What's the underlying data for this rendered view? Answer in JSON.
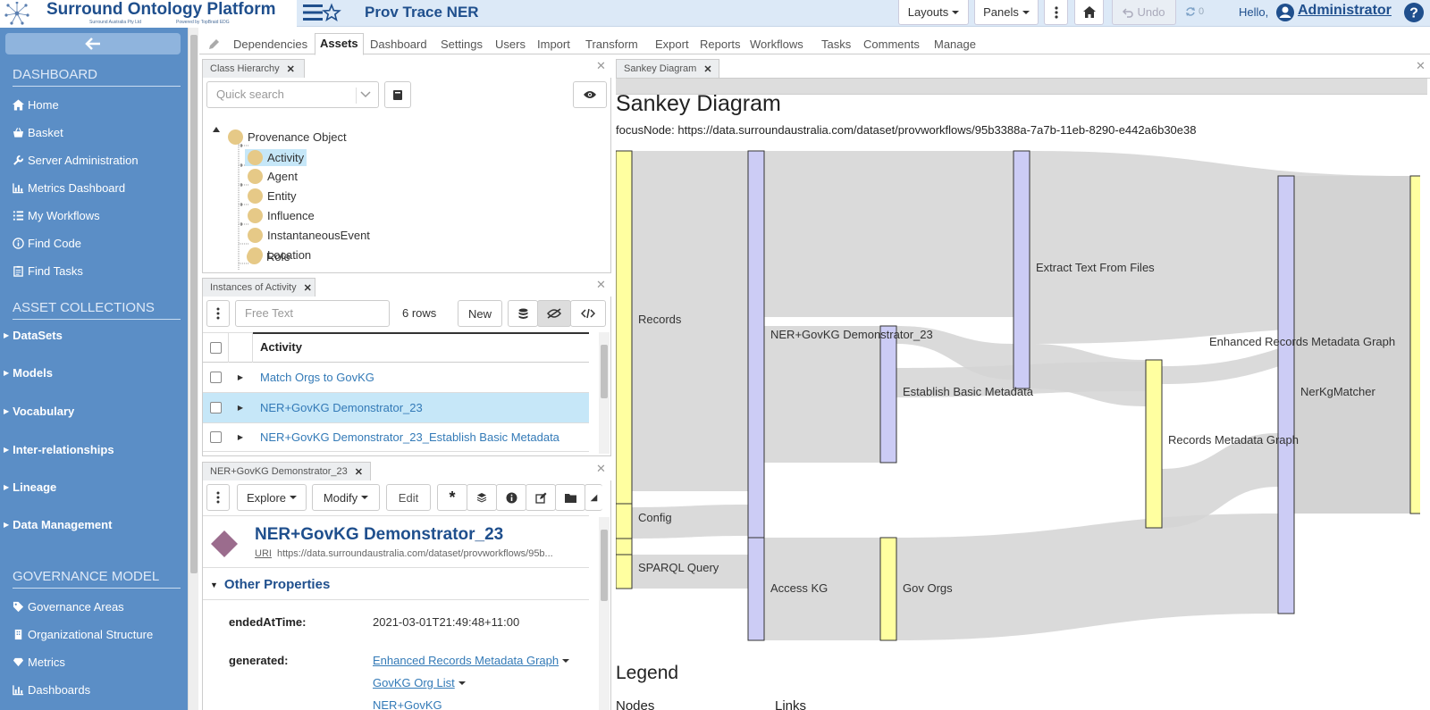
{
  "app": {
    "logo_title": "Surround Ontology Platform",
    "logo_sub_left": "Surround Australia Pty Ltd",
    "logo_sub_right": "Powered by TopBraid EDG",
    "title": "Prov Trace NER",
    "layouts_label": "Layouts",
    "panels_label": "Panels",
    "undo_label": "Undo",
    "redo_count": "0",
    "hello_label": "Hello,",
    "user": "Administrator"
  },
  "sidebar": {
    "sections": [
      {
        "title": "DASHBOARD"
      },
      {
        "title": "ASSET COLLECTIONS"
      },
      {
        "title": "GOVERNANCE MODEL"
      }
    ],
    "dashboard_items": [
      {
        "label": "Home",
        "icon": "home-icon"
      },
      {
        "label": "Basket",
        "icon": "basket-icon"
      },
      {
        "label": "Server Administration",
        "icon": "wrench-icon"
      },
      {
        "label": "Metrics Dashboard",
        "icon": "bar-chart-icon"
      },
      {
        "label": "My Workflows",
        "icon": "list-icon"
      },
      {
        "label": "Find Code",
        "icon": "info-icon"
      },
      {
        "label": "Find Tasks",
        "icon": "clipboard-icon"
      }
    ],
    "collection_items": [
      {
        "label": "DataSets"
      },
      {
        "label": "Models"
      },
      {
        "label": "Vocabulary"
      },
      {
        "label": "Inter-relationships"
      },
      {
        "label": "Lineage"
      },
      {
        "label": "Data Management"
      }
    ],
    "governance_items": [
      {
        "label": "Governance Areas",
        "icon": "tags-icon"
      },
      {
        "label": "Organizational Structure",
        "icon": "building-icon"
      },
      {
        "label": "Metrics",
        "icon": "diamond-icon"
      },
      {
        "label": "Dashboards",
        "icon": "bar-chart-icon"
      }
    ]
  },
  "tabs": [
    "Dependencies",
    "Assets",
    "Dashboard",
    "Settings",
    "Users",
    "Import",
    "Transform",
    "Export",
    "Reports",
    "Workflows",
    "Tasks",
    "Comments",
    "Manage"
  ],
  "active_tab": "Assets",
  "class_hierarchy": {
    "panel_title": "Class Hierarchy",
    "search_placeholder": "Quick search",
    "root": "Provenance Object",
    "children": [
      "Activity",
      "Agent",
      "Entity",
      "Influence",
      "InstantaneousEvent",
      "Location",
      "Role"
    ],
    "selected": "Activity"
  },
  "instances": {
    "panel_title": "Instances of Activity",
    "search_placeholder": "Free Text",
    "rows_label": "6 rows",
    "new_label": "New",
    "column_header": "Activity",
    "rows": [
      "Match Orgs to GovKG",
      "NER+GovKG Demonstrator_23",
      "NER+GovKG Demonstrator_23_Establish Basic Metadata"
    ],
    "selected_index": 1
  },
  "detail": {
    "panel_title": "NER+GovKG Demonstrator_23",
    "explore_label": "Explore",
    "modify_label": "Modify",
    "edit_label": "Edit",
    "name": "NER+GovKG Demonstrator_23",
    "uri_label": "URI",
    "uri": "https://data.surroundaustralia.com/dataset/provworkflows/95b...",
    "section_title": "Other Properties",
    "props": [
      {
        "label": "endedAtTime:",
        "value": "2021-03-01T21:49:48+11:00"
      },
      {
        "label": "generated:",
        "links": [
          "Enhanced Records Metadata Graph",
          "GovKG Org List",
          "NER+GovKG"
        ]
      }
    ]
  },
  "sankey": {
    "panel_title": "Sankey Diagram",
    "heading": "Sankey Diagram",
    "focus": "focusNode: https://data.surroundaustralia.com/dataset/provworkflows/95b3388a-7a7b-11eb-8290-e442a6b30e38",
    "legend_title": "Legend",
    "legend_nodes": "Nodes",
    "legend_links": "Links",
    "colors": {
      "entity": "#ffffa0",
      "activity": "#ccccf5",
      "link": "#d3d3d3"
    },
    "nodes": [
      {
        "id": "records",
        "label": "Records",
        "kind": "entity"
      },
      {
        "id": "config",
        "label": "Config",
        "kind": "entity"
      },
      {
        "id": "sparql",
        "label": "SPARQL Query",
        "kind": "entity"
      },
      {
        "id": "ner",
        "label": "NER+GovKG Demonstrator_23",
        "kind": "activity"
      },
      {
        "id": "access",
        "label": "Access KG",
        "kind": "activity"
      },
      {
        "id": "basic",
        "label": "Establish Basic Metadata",
        "kind": "activity"
      },
      {
        "id": "govorgs",
        "label": "Gov Orgs",
        "kind": "entity"
      },
      {
        "id": "extract",
        "label": "Extract Text From Files",
        "kind": "activity"
      },
      {
        "id": "rmg",
        "label": "Records Metadata Graph",
        "kind": "entity"
      },
      {
        "id": "nerkg",
        "label": "NerKgMatcher",
        "kind": "activity"
      },
      {
        "id": "ermg",
        "label": "Enhanced Records Metadata Graph",
        "kind": "entity"
      }
    ]
  }
}
